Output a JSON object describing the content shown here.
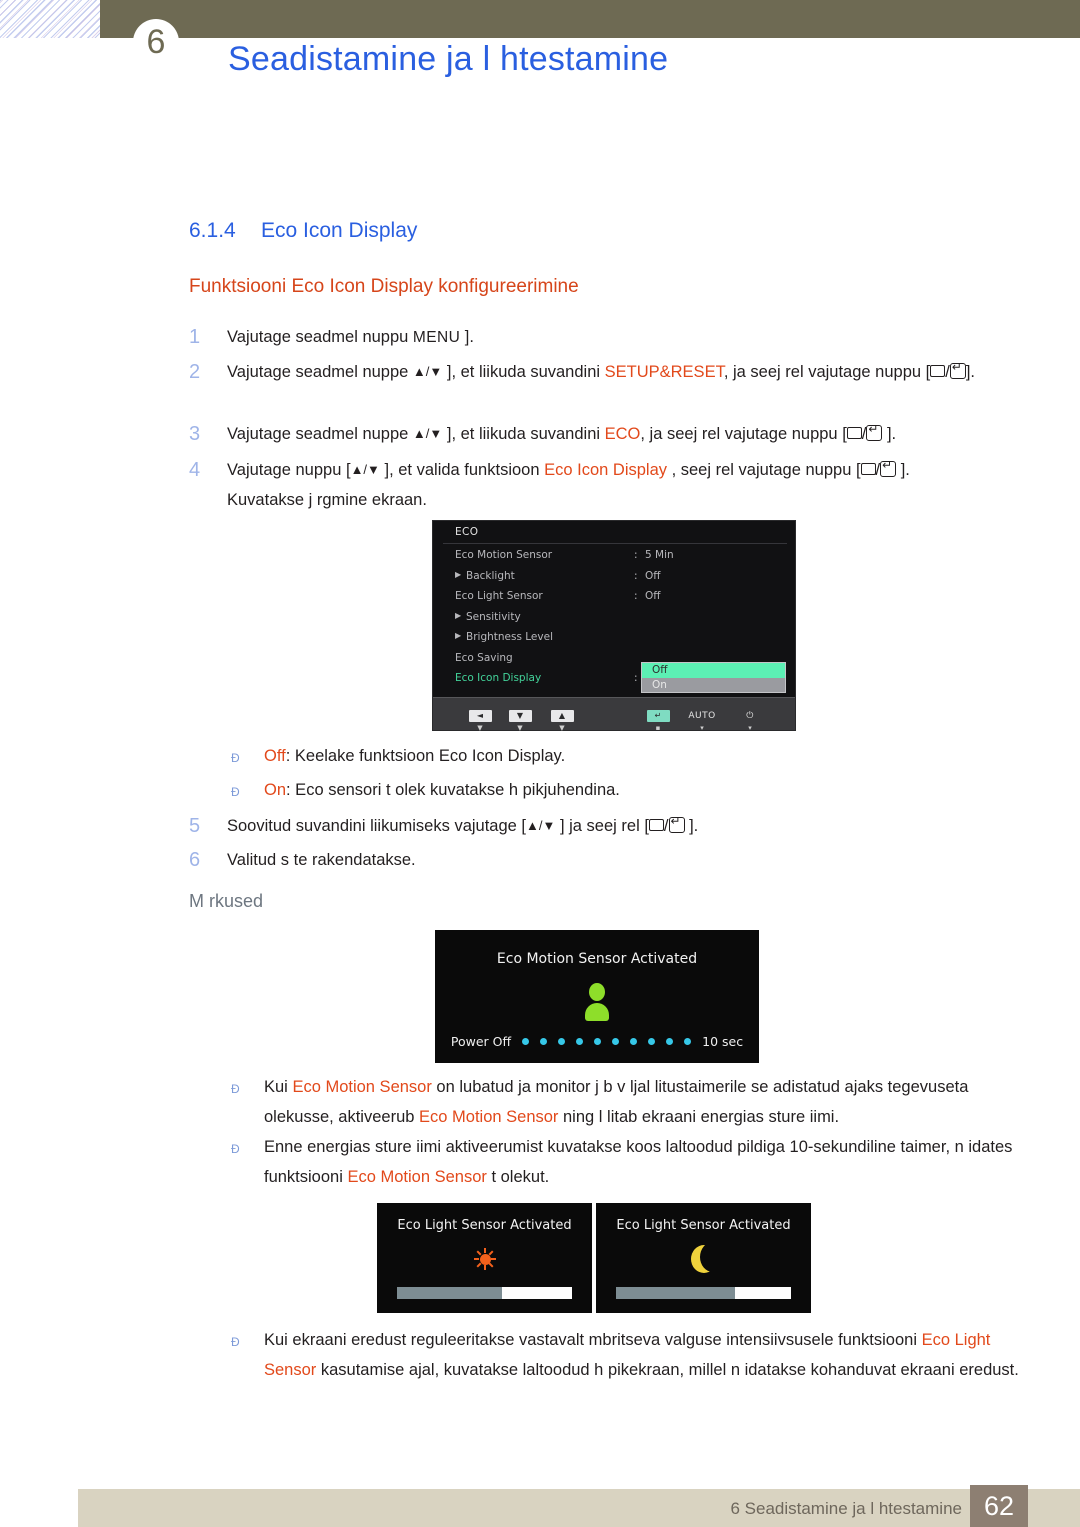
{
  "header": {
    "chapter_number": "6",
    "title": "Seadistamine ja l htestamine"
  },
  "section": {
    "number": "6.1.4",
    "title": "Eco Icon Display",
    "subtitle": "Funktsiooni Eco Icon Display konfigureerimine"
  },
  "steps": [
    {
      "n": "1",
      "parts": [
        {
          "t": "Vajutage seadmel nuppu ",
          "c": "plain"
        },
        {
          "t": "MENU",
          "c": "kbd"
        },
        {
          "t": " ].",
          "c": "plain"
        }
      ]
    },
    {
      "n": "2",
      "parts": [
        {
          "t": "Vajutage seadmel nuppe ",
          "c": "plain"
        },
        {
          "t": "▲/▼",
          "c": "glyph"
        },
        {
          "t": " ], et liikuda suvandini ",
          "c": "plain"
        },
        {
          "t": "SETUP&RESET",
          "c": "red"
        },
        {
          "t": ", ja seej rel vajutage nuppu [",
          "c": "plain"
        },
        {
          "t": "RECT/ENTER",
          "c": "btn"
        },
        {
          "t": "].",
          "c": "plain"
        }
      ]
    },
    {
      "n": "3",
      "parts": [
        {
          "t": "Vajutage seadmel nuppe ",
          "c": "plain"
        },
        {
          "t": "▲/▼",
          "c": "glyph"
        },
        {
          "t": " ], et liikuda suvandini ",
          "c": "plain"
        },
        {
          "t": "ECO",
          "c": "red"
        },
        {
          "t": ", ja seej rel vajutage nuppu [",
          "c": "plain"
        },
        {
          "t": "RECT/ENTER",
          "c": "btn"
        },
        {
          "t": " ].",
          "c": "plain"
        }
      ]
    },
    {
      "n": "4",
      "parts": [
        {
          "t": "Vajutage nuppu [",
          "c": "plain"
        },
        {
          "t": "▲/▼",
          "c": "glyph"
        },
        {
          "t": " ], et valida funktsioon ",
          "c": "plain"
        },
        {
          "t": "Eco Icon Display",
          "c": "red"
        },
        {
          "t": " , seej rel vajutage nuppu [",
          "c": "plain"
        },
        {
          "t": "RECT/ENTER",
          "c": "btn"
        },
        {
          "t": " ].",
          "c": "plain"
        }
      ],
      "second_line": "Kuvatakse j rgmine ekraan."
    },
    {
      "n": "5",
      "parts": [
        {
          "t": "Soovitud suvandini liikumiseks vajutage [",
          "c": "plain"
        },
        {
          "t": "▲/▼",
          "c": "glyph"
        },
        {
          "t": " ] ja seej rel [",
          "c": "plain"
        },
        {
          "t": "RECT/ENTER",
          "c": "btn"
        },
        {
          "t": " ].",
          "c": "plain"
        }
      ]
    },
    {
      "n": "6",
      "parts": [
        {
          "t": "Valitud s te rakendatakse.",
          "c": "plain"
        }
      ]
    }
  ],
  "option_bullets": [
    {
      "label": "Off",
      "text": ": Keelake funktsioon Eco Icon Display."
    },
    {
      "label": "On",
      "text": ": Eco sensori t olek kuvatakse h pikjuhendina."
    }
  ],
  "notes_heading": "M rkused",
  "note_bullets": [
    {
      "parts": [
        {
          "t": "Kui ",
          "c": "plain"
        },
        {
          "t": "Eco Motion Sensor",
          "c": "red"
        },
        {
          "t": " on lubatud ja monitor j b v ljal litustaimerile se adistatud ajaks tegevuseta olekusse, aktiveerub ",
          "c": "plain"
        },
        {
          "t": "Eco Motion Sensor",
          "c": "red"
        },
        {
          "t": " ning l litab ekraani energias sture iimi.",
          "c": "plain"
        }
      ]
    },
    {
      "parts": [
        {
          "t": "Enne energias sture iimi aktiveerumist kuvatakse koos laltoodud pildiga 10-sekundiline taimer, n idates funktsiooni ",
          "c": "plain"
        },
        {
          "t": "Eco Motion Sensor",
          "c": "red"
        },
        {
          "t": " t olekut.",
          "c": "plain"
        }
      ]
    },
    {
      "parts": [
        {
          "t": "Kui ekraani eredust reguleeritakse vastavalt mbritseva valguse intensiivsusele funktsiooni ",
          "c": "plain"
        },
        {
          "t": "Eco Light Sensor",
          "c": "red"
        },
        {
          "t": " kasutamise ajal, kuvatakse laltoodud h pikekraan, millel n idatakse kohanduvat ekraani eredust.",
          "c": "plain"
        }
      ]
    }
  ],
  "osd": {
    "title": "ECO",
    "rows": [
      {
        "label": "Eco Motion Sensor",
        "arrow": false,
        "colon": ":",
        "value": "5 Min",
        "active": false
      },
      {
        "label": "Backlight",
        "arrow": true,
        "colon": ":",
        "value": "Off",
        "active": false
      },
      {
        "label": "Eco Light Sensor",
        "arrow": false,
        "colon": ":",
        "value": "Off",
        "active": false
      },
      {
        "label": "Sensitivity",
        "arrow": true,
        "colon": "",
        "value": "",
        "active": false
      },
      {
        "label": "Brightness Level",
        "arrow": true,
        "colon": "",
        "value": "",
        "active": false
      },
      {
        "label": "Eco Saving",
        "arrow": false,
        "colon": "",
        "value": "",
        "active": false
      },
      {
        "label": "Eco Icon Display",
        "arrow": false,
        "colon": ":",
        "value": "",
        "active": true
      }
    ],
    "popup": {
      "options": [
        "Off",
        "On"
      ],
      "selected": "Off"
    },
    "bottom_bar": [
      {
        "icon": "◄",
        "name": "left-arrow",
        "kind": "box",
        "sub": "▼"
      },
      {
        "icon": "▼",
        "name": "down-arrow",
        "kind": "box",
        "sub": "▼"
      },
      {
        "icon": "▲",
        "name": "up-arrow",
        "kind": "box",
        "sub": "▼"
      },
      {
        "icon": "↵",
        "name": "enter",
        "kind": "box-teal",
        "sub": "▪"
      },
      {
        "icon": "AUTO",
        "name": "auto",
        "kind": "text",
        "sub": "▾"
      },
      {
        "icon": "⏻",
        "name": "power",
        "kind": "text",
        "sub": "▾"
      }
    ]
  },
  "motion_popup": {
    "title": "Eco Motion Sensor Activated",
    "left_label": "Power Off",
    "right_label": "10 sec",
    "dot_count": 10,
    "dot_color": "#36c8e8",
    "person_color": "#8ede2a"
  },
  "light_popups": [
    {
      "title": "Eco Light Sensor Activated",
      "icon": "sun-icon",
      "fill_percent": 40,
      "icon_color": "#f4611c"
    },
    {
      "title": "Eco Light Sensor Activated",
      "icon": "moon-icon",
      "fill_percent": 32,
      "icon_color": "#efd23c"
    }
  ],
  "footer": {
    "text": "6 Seadistamine ja l htestamine",
    "page": "62"
  },
  "colors": {
    "heading_blue": "#2a5fe0",
    "accent_red": "#d6451a",
    "olive": "#6e6a53",
    "footer_bg": "#d9d3c1",
    "page_badge": "#8d7f72",
    "step_number": "#9fb4e8"
  }
}
